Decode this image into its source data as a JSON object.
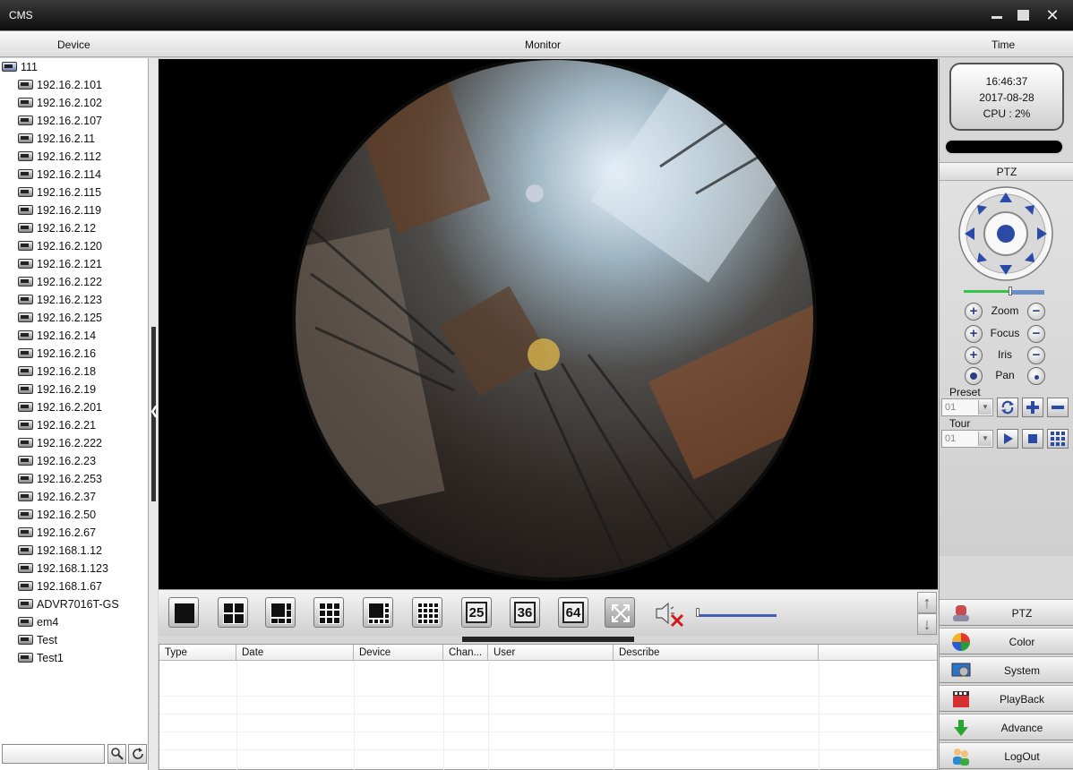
{
  "window": {
    "title": "CMS"
  },
  "headers": {
    "device": "Device",
    "monitor": "Monitor",
    "time": "Time"
  },
  "device_tree": {
    "root": "111",
    "items": [
      "192.16.2.101",
      "192.16.2.102",
      "192.16.2.107",
      "192.16.2.11",
      "192.16.2.112",
      "192.16.2.114",
      "192.16.2.115",
      "192.16.2.119",
      "192.16.2.12",
      "192.16.2.120",
      "192.16.2.121",
      "192.16.2.122",
      "192.16.2.123",
      "192.16.2.125",
      "192.16.2.14",
      "192.16.2.16",
      "192.16.2.18",
      "192.16.2.19",
      "192.16.2.201",
      "192.16.2.21",
      "192.16.2.222",
      "192.16.2.23",
      "192.16.2.253",
      "192.16.2.37",
      "192.16.2.50",
      "192.16.2.67",
      "192.168.1.12",
      "192.168.1.123",
      "192.168.1.67",
      "ADVR7016T-GS",
      "em4",
      "Test",
      "Test1"
    ],
    "search_value": ""
  },
  "status": {
    "time": "16:46:37",
    "date": "2017-08-28",
    "cpu": "CPU : 2%"
  },
  "ptz": {
    "title": "PTZ",
    "controls": [
      {
        "label": "Zoom"
      },
      {
        "label": "Focus"
      },
      {
        "label": "Iris"
      },
      {
        "label": "Pan"
      }
    ],
    "preset_label": "Preset",
    "preset_value": "01",
    "tour_label": "Tour",
    "tour_value": "01",
    "speed_fraction": 0.55
  },
  "layout_toolbar": {
    "buttons": [
      "1",
      "4",
      "6",
      "9",
      "8",
      "16",
      "25",
      "36",
      "64"
    ],
    "volume_fraction": 0.0
  },
  "log_table": {
    "columns": [
      "Type",
      "Date",
      "Device",
      "Chan...",
      "User",
      "Describe"
    ]
  },
  "menu": [
    {
      "label": "PTZ",
      "icon": "ptz-icon"
    },
    {
      "label": "Color",
      "icon": "color-icon"
    },
    {
      "label": "System",
      "icon": "system-icon"
    },
    {
      "label": "PlayBack",
      "icon": "playback-icon"
    },
    {
      "label": "Advance",
      "icon": "advance-icon"
    },
    {
      "label": "LogOut",
      "icon": "logout-icon"
    }
  ],
  "colors": {
    "titlebar": "#1a1a1a",
    "accent_blue": "#2b3f84",
    "video_bg": "#000000"
  }
}
